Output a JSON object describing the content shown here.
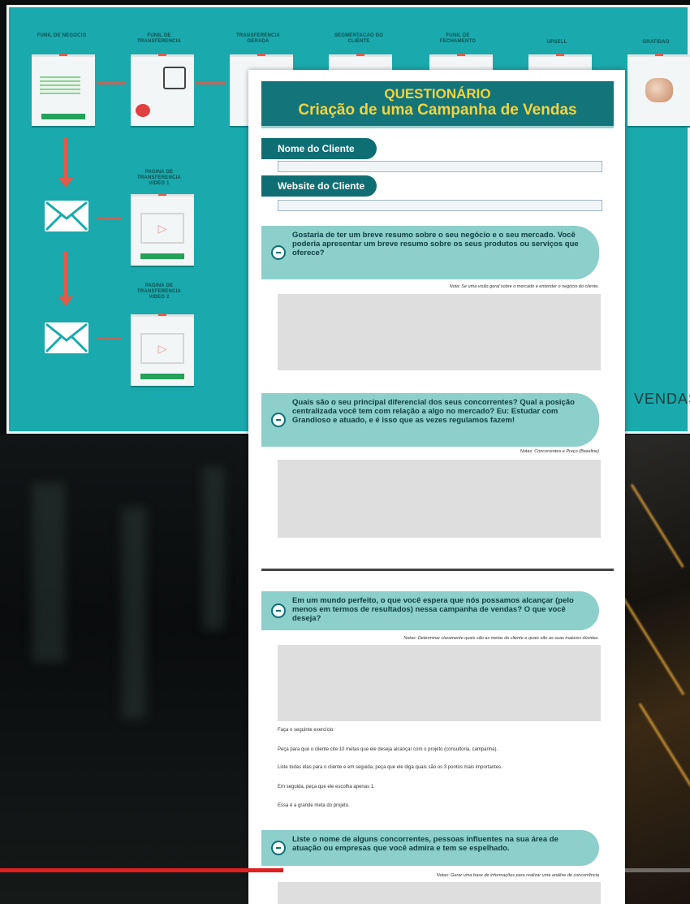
{
  "flow": {
    "step_labels": [
      "FUNIL DE NEGOCIO",
      "FUNIL DE TRANSFERENCIA",
      "TRANSFERENCIA GERADA",
      "SEGMENTACAO DO CLIENTE",
      "FUNIL DE FECHAMENTO",
      "UPSELL",
      "GRATIDAO"
    ],
    "side_labels": [
      "PAGINA DE TRANSFERENCIA VIDEO 1",
      "PAGINA DE TRANSFERENCIA VIDEO 2"
    ],
    "watermark": "VENDAS",
    "accent": "#1aa9ac",
    "arrow_color": "#e25a4a"
  },
  "document": {
    "title_line1": "QUESTIONÁRIO",
    "title_line2": "Criação de uma Campanha de Vendas",
    "field_client_name": "Nome do Cliente",
    "field_client_website": "Website do Cliente",
    "q1": "Gostaria de ter um breve resumo sobre o seu negócio e o seu mercado. Você poderia apresentar um breve resumo sobre os seus produtos ou serviços que oferece?",
    "q1_note": "Nota: Se uma visão geral sobre o mercado e entender o negócio do cliente.",
    "q2": "Quais são o seu principal diferencial dos seus concorrentes? Qual a posição centralizada você tem com relação a algo no mercado? Eu: Estudar com Grandioso e atuado, e é isso que as vezes regulamos fazem!",
    "q2_note": "Notas: Concorrentes e Preço (Baseline)",
    "q3": "Em um mundo perfeito, o que você espera que nós possamos alcançar (pelo menos em termos de resultados) nessa campanha de vendas? O que você deseja?",
    "q3_note": "Notas: Determinar claramente quais são as metas do cliente e quais são as suas maiores dúvidas.",
    "body_lines": [
      "Faça o seguinte exercício:",
      "Peça para que o cliente cite 10 metas que ele deseja alcançar com o projeto (consultoria, campanha).",
      "Liste todas elas para o cliente e em seguida, peça que ele diga quais são os 3 pontos mais importantes.",
      "Em seguida, peça que ele escolha apenas 1.",
      "Essa é a grande meta do projeto."
    ],
    "q4": "Liste o nome de alguns concorrentes, pessoas influentes na sua área de atuação ou empresas que você admira e tem se espelhado.",
    "q4_note": "Notas: Gerar uma base de informações para realizar uma análise de concorrência",
    "header_color": "#13747a",
    "title_color": "#f6d33a",
    "question_bg": "#8ccfcb"
  },
  "video": {
    "progress": 0.41,
    "progress_color": "#e02020"
  }
}
